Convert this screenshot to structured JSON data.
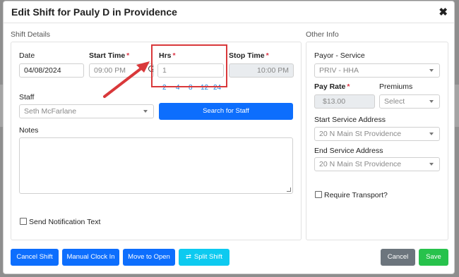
{
  "modal": {
    "title": "Edit Shift for Pauly D in Providence",
    "close_icon": "close-icon"
  },
  "shift_details": {
    "section_label": "Shift Details",
    "date": {
      "label": "Date",
      "value": "04/08/2024"
    },
    "start_time": {
      "label": "Start Time",
      "required": "*",
      "value": "09:00 PM",
      "clock_icon": "clock-icon"
    },
    "hrs": {
      "label": "Hrs",
      "required": "*",
      "value": "1",
      "quick_options": [
        "2",
        "4",
        "8",
        "12",
        "24"
      ]
    },
    "stop_time": {
      "label": "Stop Time",
      "required": "*",
      "value": "10:00 PM"
    },
    "staff": {
      "label": "Staff",
      "value": "Seth McFarlane"
    },
    "search_staff_label": "Search for Staff",
    "notes": {
      "label": "Notes",
      "value": ""
    },
    "send_notification_label": "Send Notification Text",
    "send_notification_checked": false
  },
  "other_info": {
    "section_label": "Other Info",
    "payor_service": {
      "label": "Payor - Service",
      "value": "PRIV - HHA"
    },
    "pay_rate": {
      "label": "Pay Rate",
      "required": "*",
      "value": "$13.00"
    },
    "premiums": {
      "label": "Premiums",
      "placeholder": "Select"
    },
    "start_service_address": {
      "label": "Start Service Address",
      "value": "20 N Main St Providence"
    },
    "end_service_address": {
      "label": "End Service Address",
      "value": "20 N Main St Providence"
    },
    "require_transport_label": "Require Transport?",
    "require_transport_checked": false
  },
  "footer": {
    "cancel_shift": "Cancel Shift",
    "manual_clock_in": "Manual Clock In",
    "move_to_open": "Move to Open",
    "split_shift": "Split Shift",
    "split_shift_icon": "shuffle-icon",
    "cancel": "Cancel",
    "save": "Save"
  },
  "colors": {
    "primary": "#0d6efd",
    "info": "#0dcaf0",
    "secondary": "#6c757d",
    "success": "#27c24c",
    "annotation_red": "#d9383a",
    "required": "#dc3545"
  }
}
